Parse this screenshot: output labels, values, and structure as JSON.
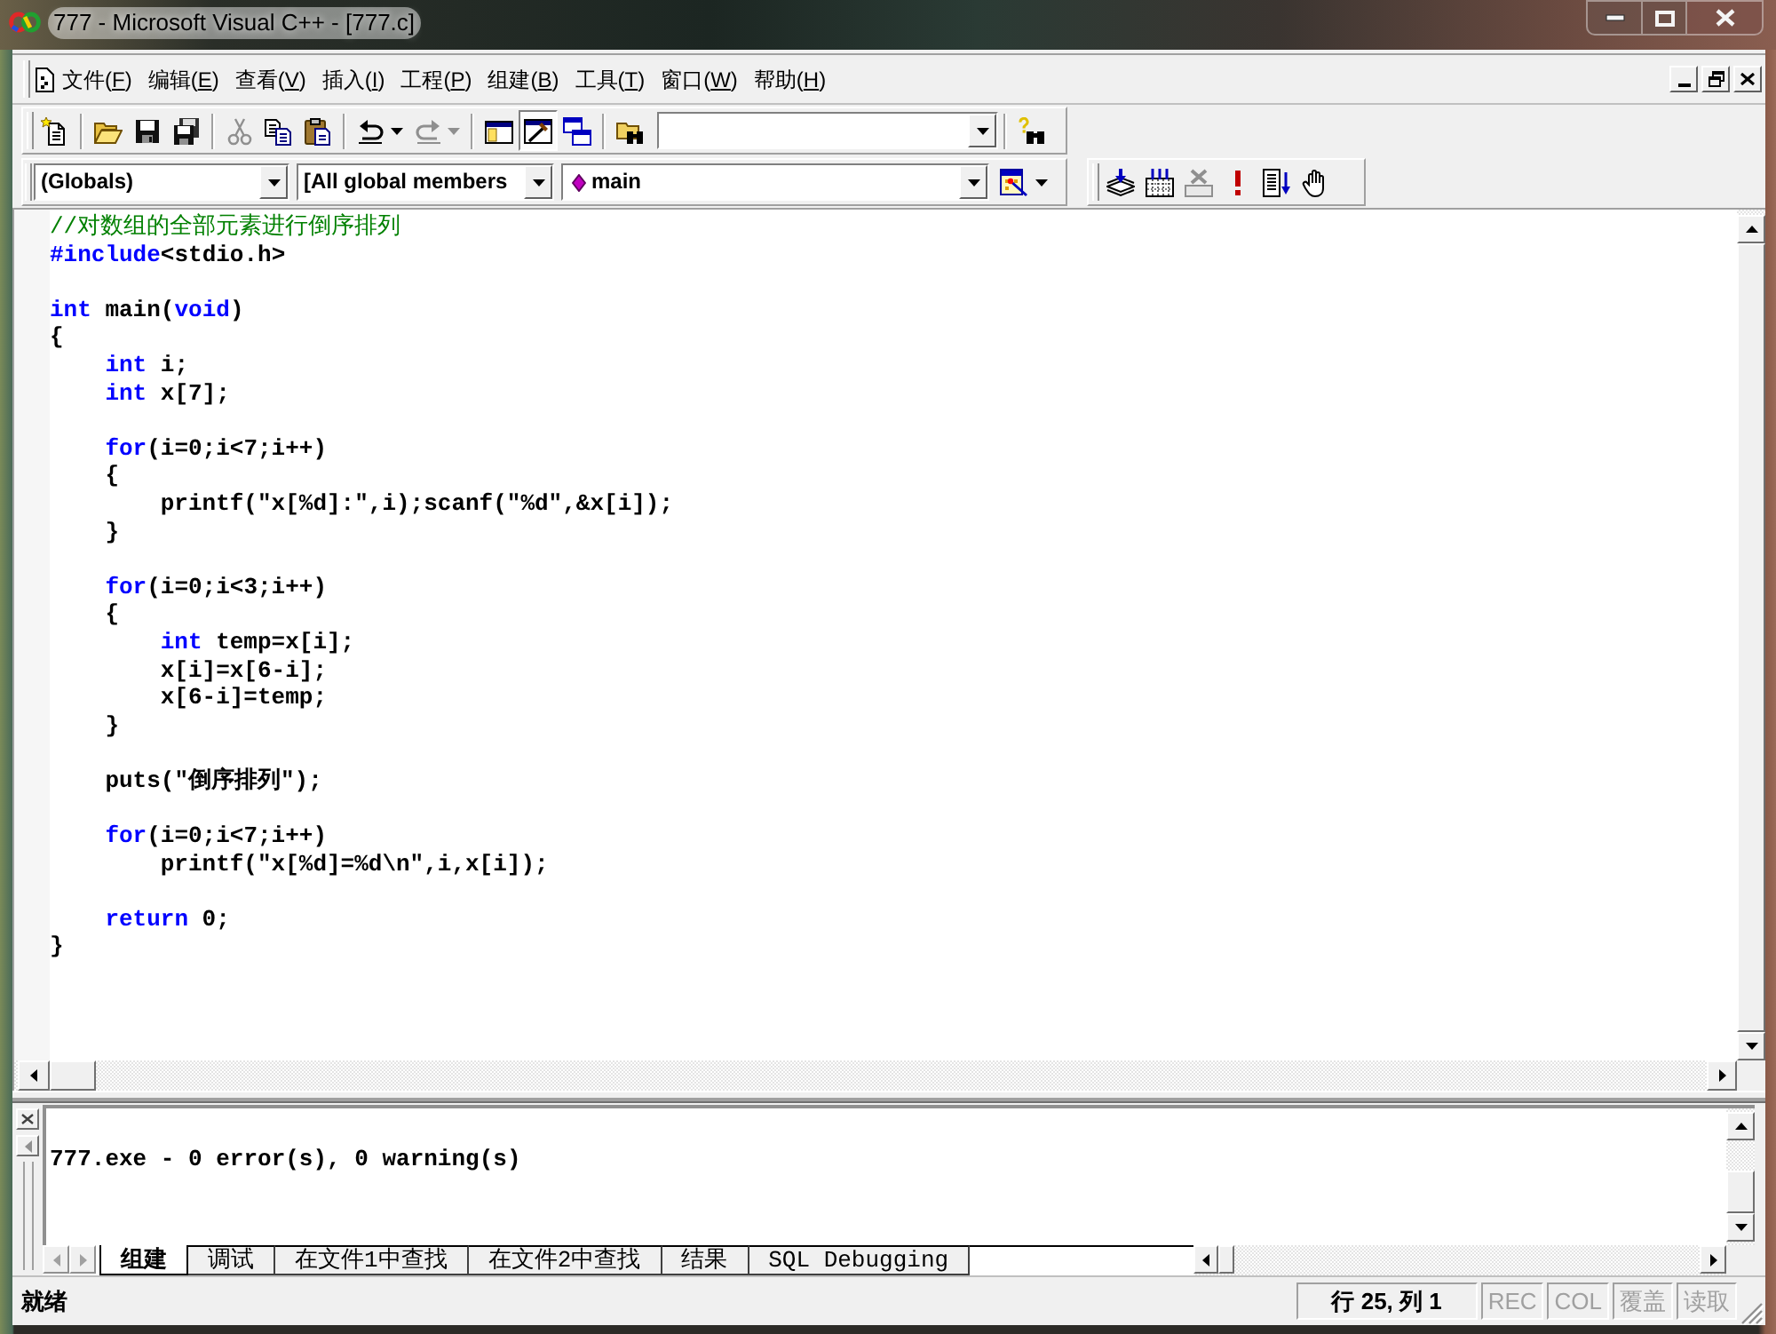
{
  "window": {
    "title": "777 - Microsoft Visual C++ - [777.c]"
  },
  "menu_bar": {
    "items": [
      {
        "label": "文件(F)"
      },
      {
        "label": "编辑(E)"
      },
      {
        "label": "查看(V)"
      },
      {
        "label": "插入(I)"
      },
      {
        "label": "工程(P)"
      },
      {
        "label": "组建(B)"
      },
      {
        "label": "工具(T)"
      },
      {
        "label": "窗口(W)"
      },
      {
        "label": "帮助(H)"
      }
    ]
  },
  "standard_toolbar": {
    "buttons": [
      {
        "disabled": false,
        "pressed": false
      },
      {
        "disabled": false,
        "pressed": false
      },
      {
        "disabled": false,
        "pressed": false
      },
      {
        "disabled": false,
        "pressed": false
      },
      {
        "disabled": true,
        "pressed": false
      },
      {
        "disabled": false,
        "pressed": false
      },
      {
        "disabled": false,
        "pressed": false
      },
      {
        "disabled": false,
        "pressed": false
      },
      {
        "disabled": true,
        "pressed": false
      },
      {
        "disabled": false,
        "pressed": false
      },
      {
        "disabled": false,
        "pressed": true
      },
      {
        "disabled": false,
        "pressed": false
      },
      {
        "disabled": false,
        "pressed": false
      },
      {
        "disabled": false,
        "pressed": false
      }
    ]
  },
  "wizard_bar": {
    "combos": [
      {
        "kind": "text",
        "value": "(Globals)"
      },
      {
        "kind": "text",
        "value": "[All global members"
      },
      {
        "kind": "function",
        "value": "main"
      }
    ]
  },
  "build_toolbar": {
    "buttons": [
      {
        "disabled": false
      },
      {
        "disabled": false
      },
      {
        "disabled": true
      },
      {
        "disabled": false
      },
      {
        "disabled": false
      },
      {
        "disabled": false
      }
    ]
  },
  "editor": {
    "lines": [
      {
        "kind": "code",
        "segments": [
          {
            "kind": "comment",
            "text": "//对数组的全部元素进行倒序排列"
          }
        ]
      },
      {
        "kind": "code",
        "segments": [
          {
            "kind": "keyword",
            "text": "#include"
          },
          {
            "kind": "plain",
            "text": "<stdio.h>"
          }
        ]
      },
      {
        "kind": "blank"
      },
      {
        "kind": "code",
        "segments": [
          {
            "kind": "keyword",
            "text": "int"
          },
          {
            "kind": "plain",
            "text": " main("
          },
          {
            "kind": "keyword",
            "text": "void"
          },
          {
            "kind": "plain",
            "text": ")"
          }
        ]
      },
      {
        "kind": "code",
        "segments": [
          {
            "kind": "plain",
            "text": "{"
          }
        ],
        "children": [
          {
            "kind": "code",
            "segments": [
              {
                "kind": "keyword",
                "text": "int"
              },
              {
                "kind": "plain",
                "text": " i;"
              }
            ]
          },
          {
            "kind": "code",
            "segments": [
              {
                "kind": "keyword",
                "text": "int"
              },
              {
                "kind": "plain",
                "text": " x[7];"
              }
            ]
          },
          {
            "kind": "blank"
          },
          {
            "kind": "code",
            "segments": [
              {
                "kind": "keyword",
                "text": "for"
              },
              {
                "kind": "plain",
                "text": "(i=0;i<7;i++)"
              }
            ]
          },
          {
            "kind": "code",
            "segments": [
              {
                "kind": "plain",
                "text": "{"
              }
            ],
            "children": [
              {
                "kind": "code",
                "segments": [
                  {
                    "kind": "plain",
                    "text": "printf(\"x[%d]:\",i);scanf(\"%d\",&x[i]);"
                  }
                ]
              }
            ]
          },
          {
            "kind": "code",
            "segments": [
              {
                "kind": "plain",
                "text": "}"
              }
            ]
          },
          {
            "kind": "blank"
          },
          {
            "kind": "code",
            "segments": [
              {
                "kind": "keyword",
                "text": "for"
              },
              {
                "kind": "plain",
                "text": "(i=0;i<3;i++)"
              }
            ]
          },
          {
            "kind": "code",
            "segments": [
              {
                "kind": "plain",
                "text": "{"
              }
            ],
            "children": [
              {
                "kind": "code",
                "segments": [
                  {
                    "kind": "keyword",
                    "text": "int"
                  },
                  {
                    "kind": "plain",
                    "text": " temp=x[i];"
                  }
                ]
              },
              {
                "kind": "code",
                "segments": [
                  {
                    "kind": "plain",
                    "text": "x[i]=x[6-i];"
                  }
                ]
              },
              {
                "kind": "code",
                "segments": [
                  {
                    "kind": "plain",
                    "text": "x[6-i]=temp;"
                  }
                ]
              }
            ]
          },
          {
            "kind": "code",
            "segments": [
              {
                "kind": "plain",
                "text": "}"
              }
            ]
          },
          {
            "kind": "blank"
          },
          {
            "kind": "code",
            "segments": [
              {
                "kind": "plain",
                "text": "puts(\"倒序排列\");"
              }
            ]
          },
          {
            "kind": "blank"
          },
          {
            "kind": "code",
            "segments": [
              {
                "kind": "keyword",
                "text": "for"
              },
              {
                "kind": "plain",
                "text": "(i=0;i<7;i++)"
              }
            ],
            "children": [
              {
                "kind": "code",
                "segments": [
                  {
                    "kind": "plain",
                    "text": "printf(\"x[%d]=%d\\n\",i,x[i]);"
                  }
                ]
              }
            ]
          },
          {
            "kind": "blank"
          },
          {
            "kind": "code",
            "segments": [
              {
                "kind": "keyword",
                "text": "return"
              },
              {
                "kind": "plain",
                "text": " 0;"
              }
            ]
          }
        ]
      },
      {
        "kind": "code",
        "segments": [
          {
            "kind": "plain",
            "text": "}"
          }
        ]
      }
    ]
  },
  "output": {
    "text": "777.exe - 0 error(s), 0 warning(s)",
    "tabs": [
      {
        "label": "组建",
        "selected": true
      },
      {
        "label": "调试",
        "selected": false
      },
      {
        "label": "在文件1中查找",
        "selected": false
      },
      {
        "label": "在文件2中查找",
        "selected": false
      },
      {
        "label": "结果",
        "selected": false
      },
      {
        "label": "SQL Debugging",
        "selected": false
      }
    ]
  },
  "status_bar": {
    "message": "就绪",
    "position": "行 25, 列 1",
    "indicators": [
      {
        "label": "REC",
        "on": false
      },
      {
        "label": "COL",
        "on": false
      },
      {
        "label": "覆盖",
        "on": false
      },
      {
        "label": "读取",
        "on": false
      }
    ]
  }
}
